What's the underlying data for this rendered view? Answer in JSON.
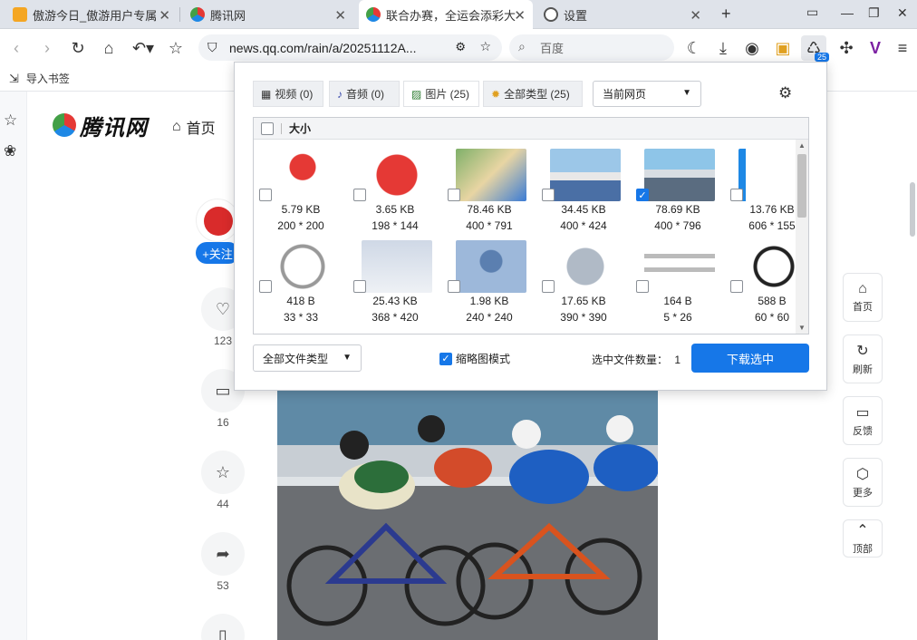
{
  "tabs": [
    {
      "title": "傲游今日_傲游用户专属"
    },
    {
      "title": "腾讯网"
    },
    {
      "title": "联合办赛，全运会添彩大"
    },
    {
      "title": "设置"
    }
  ],
  "toolbar": {
    "url": "news.qq.com/rain/a/20251112A...",
    "search_placeholder": "百度",
    "download_badge": "25"
  },
  "bookmarks": {
    "import_label": "导入书签"
  },
  "site": {
    "logo": "腾讯网",
    "home_label": "首页",
    "follow_label": "+关注",
    "actions": [
      {
        "icon": "heart-icon",
        "count": "123"
      },
      {
        "icon": "comment-icon",
        "count": "16"
      },
      {
        "icon": "star-icon",
        "count": "44"
      },
      {
        "icon": "share-icon",
        "count": "53"
      }
    ],
    "right_rail": [
      {
        "label": "首页"
      },
      {
        "label": "刷新"
      },
      {
        "label": "反馈"
      },
      {
        "label": "更多"
      },
      {
        "label": "顶部"
      }
    ]
  },
  "sniffer": {
    "tabs": [
      {
        "label": "视频 (0)"
      },
      {
        "label": "音频 (0)"
      },
      {
        "label": "图片 (25)"
      },
      {
        "label": "全部类型 (25)"
      }
    ],
    "scope": "当前网页",
    "column_header": "大小",
    "items": [
      {
        "size": "5.79 KB",
        "dims": "200 * 200",
        "checked": false
      },
      {
        "size": "3.65 KB",
        "dims": "198 * 144",
        "checked": false
      },
      {
        "size": "78.46 KB",
        "dims": "400 * 791",
        "checked": false
      },
      {
        "size": "34.45 KB",
        "dims": "400 * 424",
        "checked": false
      },
      {
        "size": "78.69 KB",
        "dims": "400 * 796",
        "checked": true
      },
      {
        "size": "13.76 KB",
        "dims": "606 * 155",
        "checked": false
      },
      {
        "size": "418 B",
        "dims": "33 * 33",
        "checked": false
      },
      {
        "size": "25.43 KB",
        "dims": "368 * 420",
        "checked": false
      },
      {
        "size": "1.98 KB",
        "dims": "240 * 240",
        "checked": false
      },
      {
        "size": "17.65 KB",
        "dims": "390 * 390",
        "checked": false
      },
      {
        "size": "164 B",
        "dims": "5 * 26",
        "checked": false
      },
      {
        "size": "588 B",
        "dims": "60 * 60",
        "checked": false
      }
    ],
    "filetype": "全部文件类型",
    "thumbnail_mode": "缩略图模式",
    "selected_label": "选中文件数量：",
    "selected_count": "1",
    "download_button": "下载选中"
  }
}
